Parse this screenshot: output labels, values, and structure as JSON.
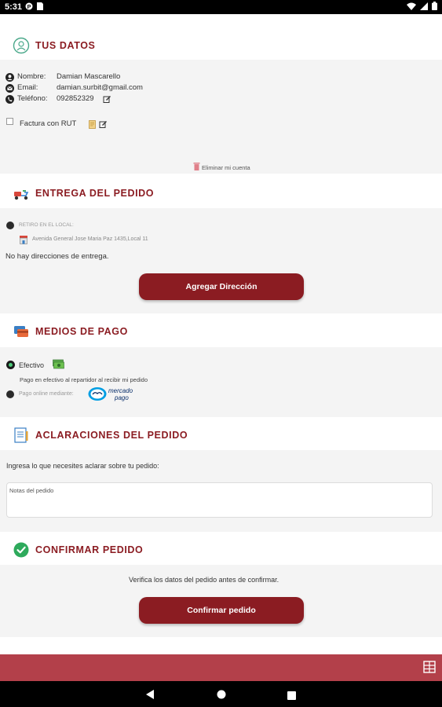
{
  "status_bar": {
    "time": "5:31"
  },
  "tus_datos": {
    "title": "TUS DATOS",
    "nombre_label": "Nombre:",
    "nombre_value": "Damian Mascarello",
    "email_label": "Email:",
    "email_value": "damian.surbit@gmail.com",
    "telefono_label": "Teléfono:",
    "telefono_value": "092852329",
    "factura_label": "Factura con RUT",
    "eliminar_label": "Eliminar mi cuenta"
  },
  "entrega": {
    "title": "ENTREGA DEL PEDIDO",
    "retiro_label": "RETIRO EN EL LOCAL:",
    "local_address": "Avenida General Jose Maria Paz 1435,Local 11",
    "no_direcciones": "No hay direcciones de entrega.",
    "agregar_button": "Agregar Dirección"
  },
  "medios_pago": {
    "title": "MEDIOS DE PAGO",
    "efectivo_label": "Efectivo",
    "efectivo_desc": "Pago en efectivo al repartidor al recibir mi pedido",
    "online_label": "Pago online mediante:",
    "mercado_pago_text_1": "mercado",
    "mercado_pago_text_2": "pago"
  },
  "aclaraciones": {
    "title": "ACLARACIONES DEL PEDIDO",
    "prompt": "Ingresa lo que necesites aclarar sobre tu pedido:",
    "notes_label": "Notas del pedido",
    "notes_value": ""
  },
  "confirmar": {
    "title": "CONFIRMAR PEDIDO",
    "verify_text": "Verifica los datos del pedido antes de confirmar.",
    "confirm_button": "Confirmar pedido"
  },
  "colors": {
    "brand": "#8b1c22",
    "bottom_bar": "#b3404a",
    "panel_bg": "#f4f4f4",
    "success": "#2eaa5c"
  }
}
